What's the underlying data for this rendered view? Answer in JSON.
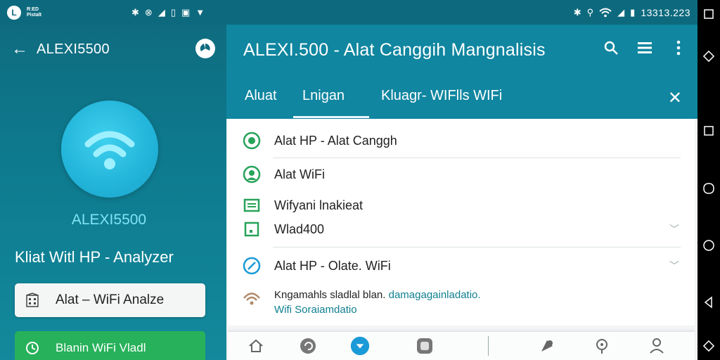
{
  "colors": {
    "toolbar": "#1086a0",
    "panel": "#0e7a8e",
    "accent": "#22b4d9",
    "green": "#27b15a"
  },
  "statusbar": {
    "tiny_line1": "R:ED",
    "tiny_line2": "Pistalt",
    "icons_left": [
      "bluetooth-icon",
      "data-icon",
      "signal-icon",
      "battery-icon",
      "sim-icon",
      "wifi-small-icon"
    ],
    "clock": "13313.223"
  },
  "left_panel": {
    "title": "ALEXI5500",
    "device_name": "ALEXI5500",
    "app_name": "Kliat Witl HP - Analyzer",
    "button1_label": "Alat – WiFi Analze",
    "button2_label": "Blanin WiFi Vladl"
  },
  "right_panel": {
    "title": "ALEXI.500 - Alat Canggih  Mangnalisis",
    "tabs": [
      "Aluat",
      "Lnigan",
      "Kluagr- WIFlls WIFi"
    ],
    "rows": [
      {
        "label": "Alat HP - Alat Canggh",
        "icon": "circle-check-icon"
      },
      {
        "label": "Alat WiFi",
        "icon": "user-circle-icon"
      },
      {
        "label": "Wifyani lnakieat",
        "icon": "document-icon"
      },
      {
        "label": "Wlad400",
        "icon": "square-icon"
      },
      {
        "label": "Alat  HP - Olate. WiFi",
        "icon": "compass-icon"
      }
    ],
    "ad_line1_dark": "Kngamahls sladlal blan. ",
    "ad_line1_teal": "damagagainladatio.",
    "ad_line2_teal": "Wifi Soraiamdatio",
    "bottom_nav_label": "..."
  }
}
